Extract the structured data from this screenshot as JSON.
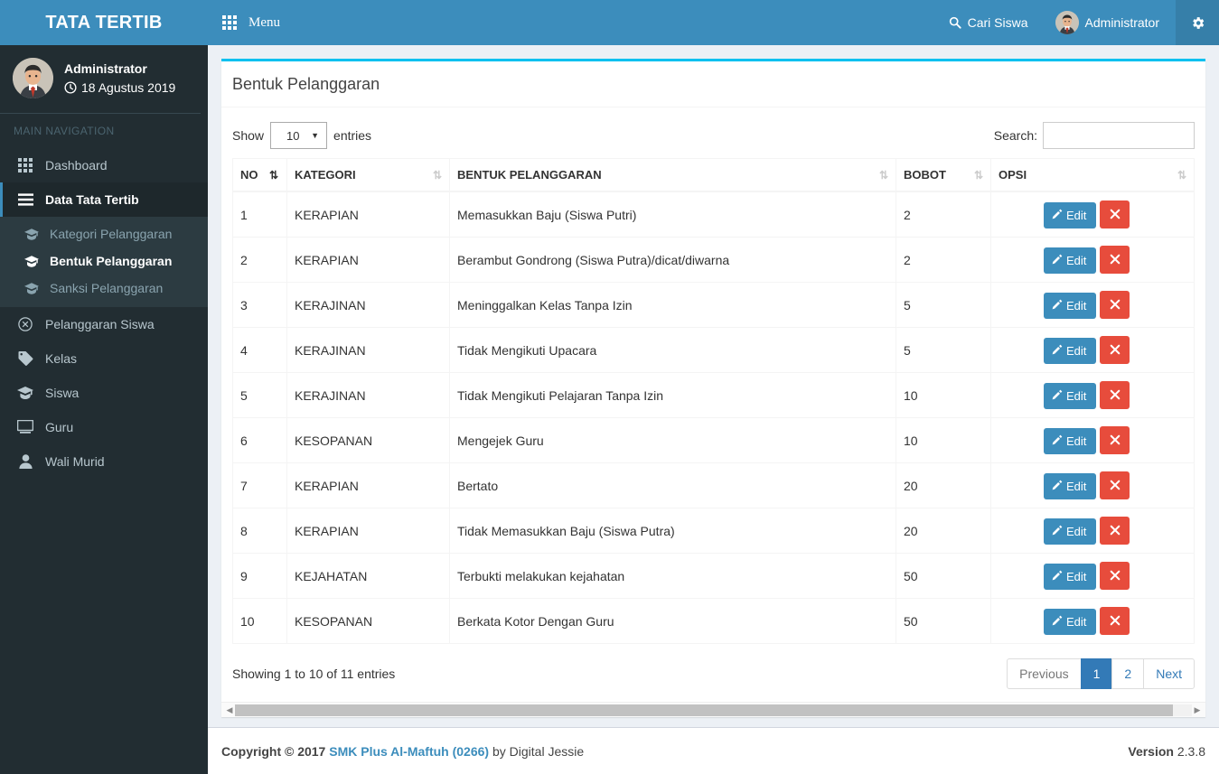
{
  "brand": {
    "logo_text": "TATA TERTIB",
    "accent": "#3c8dbc",
    "box_accent": "#00c0ef"
  },
  "navbar": {
    "menu_icon": "grid-icon",
    "menu_label": "Menu",
    "search_icon": "search-icon",
    "search_label": "Cari Siswa",
    "user_label": "Administrator",
    "avatar_icon": "avatar",
    "gear_icon": "gear-icon"
  },
  "sidebar": {
    "user": {
      "name": "Administrator",
      "clock_icon": "clock-icon",
      "date": "18 Agustus 2019"
    },
    "nav_header": "MAIN NAVIGATION",
    "items": [
      {
        "label": "Dashboard",
        "icon": "dashboard-grid-icon",
        "active": false
      },
      {
        "label": "Data Tata Tertib",
        "icon": "bars-icon",
        "active": true
      }
    ],
    "submenu": [
      {
        "label": "Kategori Pelanggaran",
        "icon": "graduation-cap-icon",
        "active": false
      },
      {
        "label": "Bentuk Pelanggaran",
        "icon": "graduation-cap-icon",
        "active": true
      },
      {
        "label": "Sanksi Pelanggaran",
        "icon": "graduation-cap-icon",
        "active": false
      }
    ],
    "items_after": [
      {
        "label": "Pelanggaran Siswa",
        "icon": "circle-x-icon"
      },
      {
        "label": "Kelas",
        "icon": "tag-icon"
      },
      {
        "label": "Siswa",
        "icon": "graduation-cap-icon"
      },
      {
        "label": "Guru",
        "icon": "desktop-icon"
      },
      {
        "label": "Wali Murid",
        "icon": "user-icon"
      }
    ]
  },
  "box": {
    "title": "Bentuk Pelanggaran"
  },
  "datatable": {
    "length_label_before": "Show",
    "length_value": "10",
    "length_label_after": "entries",
    "length_caret_icon": "caret-down-icon",
    "search_label": "Search:",
    "search_value": "",
    "search_placeholder": "",
    "columns": [
      {
        "label": "NO",
        "sorted": true,
        "sort_icon": "sort-asc-icon"
      },
      {
        "label": "KATEGORI",
        "sorted": false,
        "sort_icon": "sort-icon"
      },
      {
        "label": "BENTUK PELANGGARAN",
        "sorted": false,
        "sort_icon": "sort-icon"
      },
      {
        "label": "BOBOT",
        "sorted": false,
        "sort_icon": "sort-icon"
      },
      {
        "label": "OPSI",
        "sorted": false,
        "sort_icon": "sort-icon"
      }
    ],
    "rows": [
      {
        "no": "1",
        "kategori": "KERAPIAN",
        "bentuk": "Memasukkan Baju (Siswa Putri)",
        "bobot": "2"
      },
      {
        "no": "2",
        "kategori": "KERAPIAN",
        "bentuk": "Berambut Gondrong (Siswa Putra)/dicat/diwarna",
        "bobot": "2"
      },
      {
        "no": "3",
        "kategori": "KERAJINAN",
        "bentuk": "Meninggalkan Kelas Tanpa Izin",
        "bobot": "5"
      },
      {
        "no": "4",
        "kategori": "KERAJINAN",
        "bentuk": "Tidak Mengikuti Upacara",
        "bobot": "5"
      },
      {
        "no": "5",
        "kategori": "KERAJINAN",
        "bentuk": "Tidak Mengikuti Pelajaran Tanpa Izin",
        "bobot": "10"
      },
      {
        "no": "6",
        "kategori": "KESOPANAN",
        "bentuk": "Mengejek Guru",
        "bobot": "10"
      },
      {
        "no": "7",
        "kategori": "KERAPIAN",
        "bentuk": "Bertato",
        "bobot": "20"
      },
      {
        "no": "8",
        "kategori": "KERAPIAN",
        "bentuk": "Tidak Memasukkan Baju (Siswa Putra)",
        "bobot": "20"
      },
      {
        "no": "9",
        "kategori": "KEJAHATAN",
        "bentuk": "Terbukti melakukan kejahatan",
        "bobot": "50"
      },
      {
        "no": "10",
        "kategori": "KESOPANAN",
        "bentuk": "Berkata Kotor Dengan Guru",
        "bobot": "50"
      }
    ],
    "row_actions": {
      "edit_label": "Edit",
      "edit_icon": "pencil-icon",
      "delete_icon": "close-x-icon"
    },
    "info": "Showing 1 to 10 of 11 entries",
    "pagination": {
      "previous": "Previous",
      "pages": [
        "1",
        "2"
      ],
      "active_page": "1",
      "next": "Next"
    },
    "scrollbar": {
      "left_icon": "caret-left-icon",
      "right_icon": "caret-right-icon"
    }
  },
  "footer": {
    "copyright_prefix": "Copyright © 2017",
    "org_link": "SMK Plus Al-Maftuh (0266)",
    "copyright_suffix": "by Digital Jessie",
    "version_label": "Version",
    "version_number": "2.3.8"
  }
}
